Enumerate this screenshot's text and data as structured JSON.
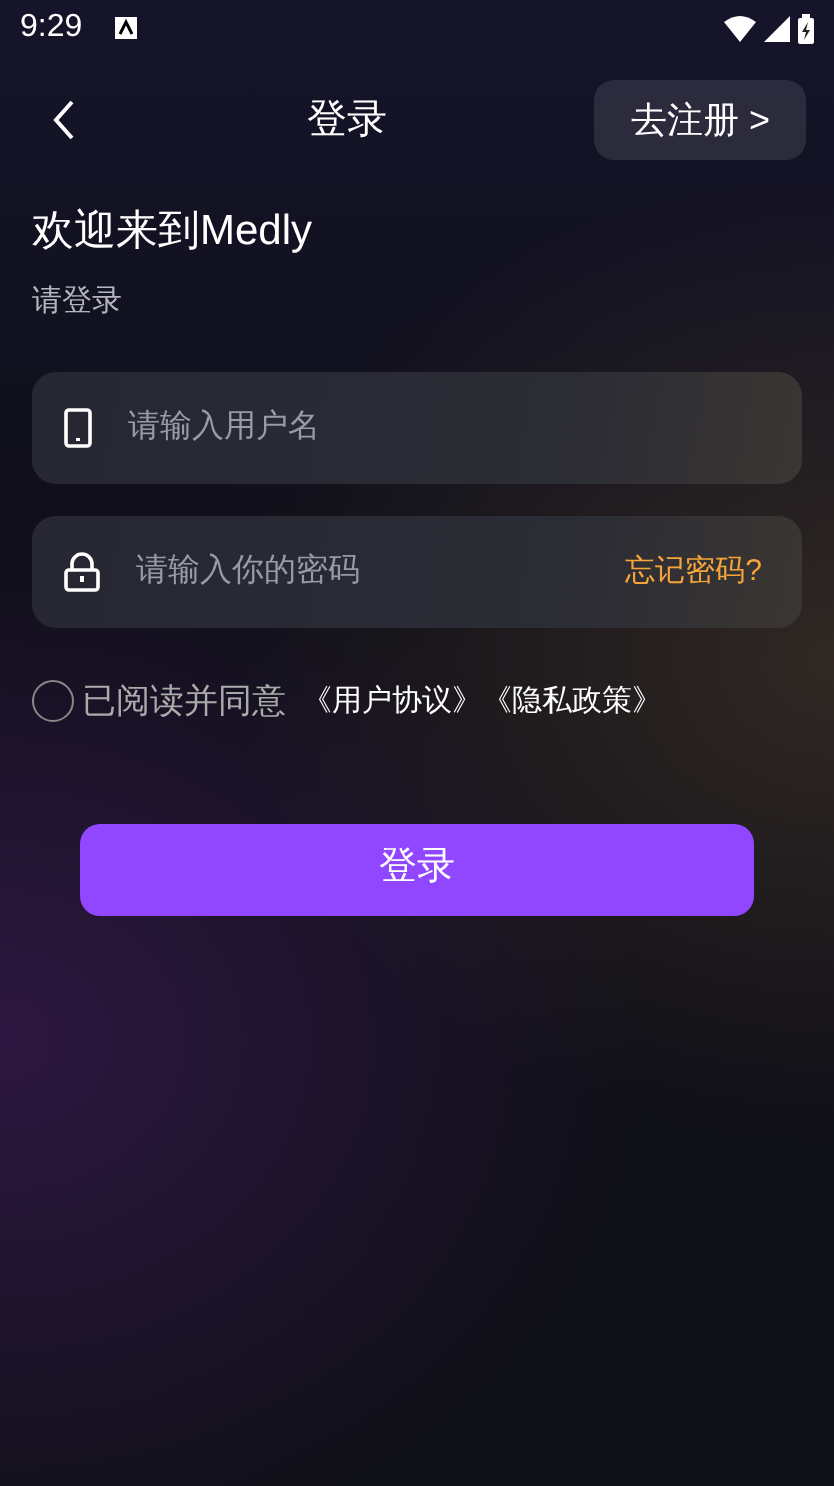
{
  "status_bar": {
    "time": "9:29"
  },
  "header": {
    "title": "登录",
    "register_button": "去注册 >"
  },
  "welcome": "欢迎来到Medly",
  "subtitle": "请登录",
  "fields": [
    {
      "kind": "phone",
      "placeholder": "请输入用户名"
    },
    {
      "kind": "password",
      "placeholder": "请输入你的密码",
      "link": "忘记密码?"
    }
  ],
  "agreement": {
    "checked": false,
    "text": "已阅读并同意",
    "links": [
      "《用户协议》",
      "《隐私政策》"
    ]
  },
  "login_button": "登录"
}
